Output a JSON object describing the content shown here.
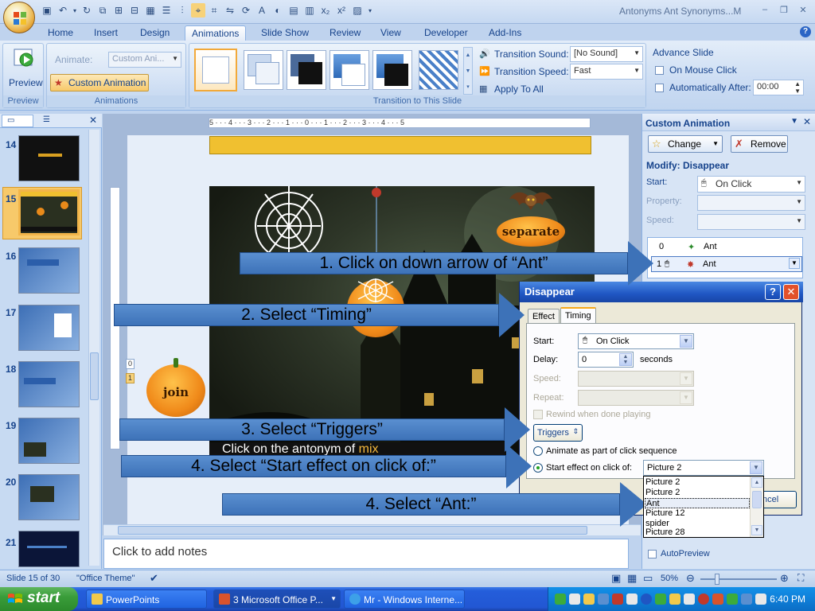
{
  "window": {
    "title": "Antonyms Ant Synonyms...M",
    "minimize": "–",
    "restore": "❐",
    "close": "✕"
  },
  "ribbon": {
    "tabs": [
      "Home",
      "Insert",
      "Design",
      "Animations",
      "Slide Show",
      "Review",
      "View",
      "Developer",
      "Add-Ins"
    ],
    "active_tab": "Animations",
    "preview_label": "Preview",
    "preview_group": "Preview",
    "animate_label": "Animate:",
    "animate_value": "Custom Ani...",
    "custom_animation_label": "Custom Animation",
    "animations_group": "Animations",
    "transition_sound_label": "Transition Sound:",
    "transition_sound_value": "[No Sound]",
    "transition_speed_label": "Transition Speed:",
    "transition_speed_value": "Fast",
    "apply_to_all_label": "Apply To All",
    "advance_slide_label": "Advance Slide",
    "on_mouse_click_label": "On Mouse Click",
    "auto_after_label": "Automatically After:",
    "auto_after_value": "00:00",
    "transition_group": "Transition to This Slide"
  },
  "slides": {
    "numbers": [
      "14",
      "15",
      "16",
      "17",
      "18",
      "19",
      "20",
      "21"
    ],
    "selected": "15"
  },
  "slide": {
    "word_separate": "separate",
    "word_join": "join",
    "caption_prefix": "Click on the antonym of ",
    "caption_word": "mix",
    "ruler_text": "5 · · · 4 · · · 3 · · · 2 · · · 1 · · · 0 · · · 1 · · · 2 · · · 3 · · · 4 · · · 5"
  },
  "notes": {
    "placeholder": "Click to add notes"
  },
  "task_pane": {
    "title": "Custom Animation",
    "change_label": "Change",
    "remove_label": "Remove",
    "modify_label": "Modify: Disappear",
    "start_label": "Start:",
    "start_value": "On Click",
    "property_label": "Property:",
    "speed_label": "Speed:",
    "list": [
      {
        "index": "0",
        "name": "Ant"
      },
      {
        "index": "1",
        "name": "Ant"
      }
    ],
    "autopreview_label": "AutoPreview"
  },
  "dialog": {
    "title": "Disappear",
    "help": "?",
    "close": "✕",
    "tabs": [
      "Effect",
      "Timing"
    ],
    "active_tab": "Timing",
    "start_label": "Start:",
    "start_value": "On Click",
    "delay_label": "Delay:",
    "delay_value": "0",
    "seconds_label": "seconds",
    "speed_label": "Speed:",
    "repeat_label": "Repeat:",
    "rewind_label": "Rewind when done playing",
    "triggers_label": "Triggers",
    "animate_seq_label": "Animate as part of click sequence",
    "start_effect_label": "Start effect on click of:",
    "start_effect_value": "Picture 2",
    "cancel_partial": "ncel",
    "options": [
      "Picture 2",
      "Picture 2",
      "Ant",
      "Picture 12",
      "spider",
      "Picture 28"
    ],
    "selected_option": "Ant"
  },
  "instructions": [
    "1. Click on down arrow of “Ant”",
    "2. Select “Timing”",
    "3. Select “Triggers”",
    "4. Select “Start effect on click of:”",
    "4. Select “Ant:”"
  ],
  "status_bar": {
    "slide_info": "Slide 15 of 30",
    "theme": "\"Office Theme\"",
    "zoom": "50%"
  },
  "taskbar": {
    "start": "start",
    "tasks": [
      "PowerPoints",
      "3 Microsoft Office P...",
      "Mr - Windows Interne..."
    ],
    "clock": "6:40 PM"
  },
  "colors": {
    "ribbon_blue": "#bfd3ee",
    "highlight_orange": "#f2b54a",
    "arrow_blue": "#3d72b8",
    "xp_title_blue": "#1f56c3"
  }
}
